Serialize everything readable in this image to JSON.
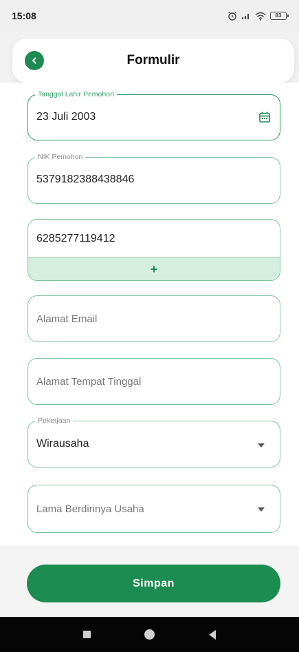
{
  "status_bar": {
    "time": "15:08",
    "battery": "83"
  },
  "header": {
    "title": "Formulir"
  },
  "form": {
    "birth_date": {
      "label": "Tanggal Lahir Pemohon",
      "value": "23 Juli 2003"
    },
    "nik": {
      "label": "NIK Pemohon",
      "value": "5379182388438846"
    },
    "phone": {
      "value": "6285277119412",
      "add_label": "+"
    },
    "email": {
      "placeholder": "Alamat Email"
    },
    "address": {
      "placeholder": "Alamat Tempat Tinggal"
    },
    "occupation": {
      "label": "Pekerjaan",
      "value": "Wirausaha"
    },
    "business_duration": {
      "placeholder": "Lama Berdirinya Usaha"
    }
  },
  "actions": {
    "save_label": "Simpan"
  },
  "colors": {
    "primary": "#1c8c50",
    "field_border": "#7cc59c",
    "phone_add_bg": "#d4efdf"
  },
  "icons": [
    "alarm-icon",
    "signal-icon",
    "wifi-icon",
    "battery-icon",
    "back-arrow-icon",
    "calendar-icon",
    "dropdown-arrow-icon",
    "nav-recents-icon",
    "nav-home-icon",
    "nav-back-icon"
  ]
}
